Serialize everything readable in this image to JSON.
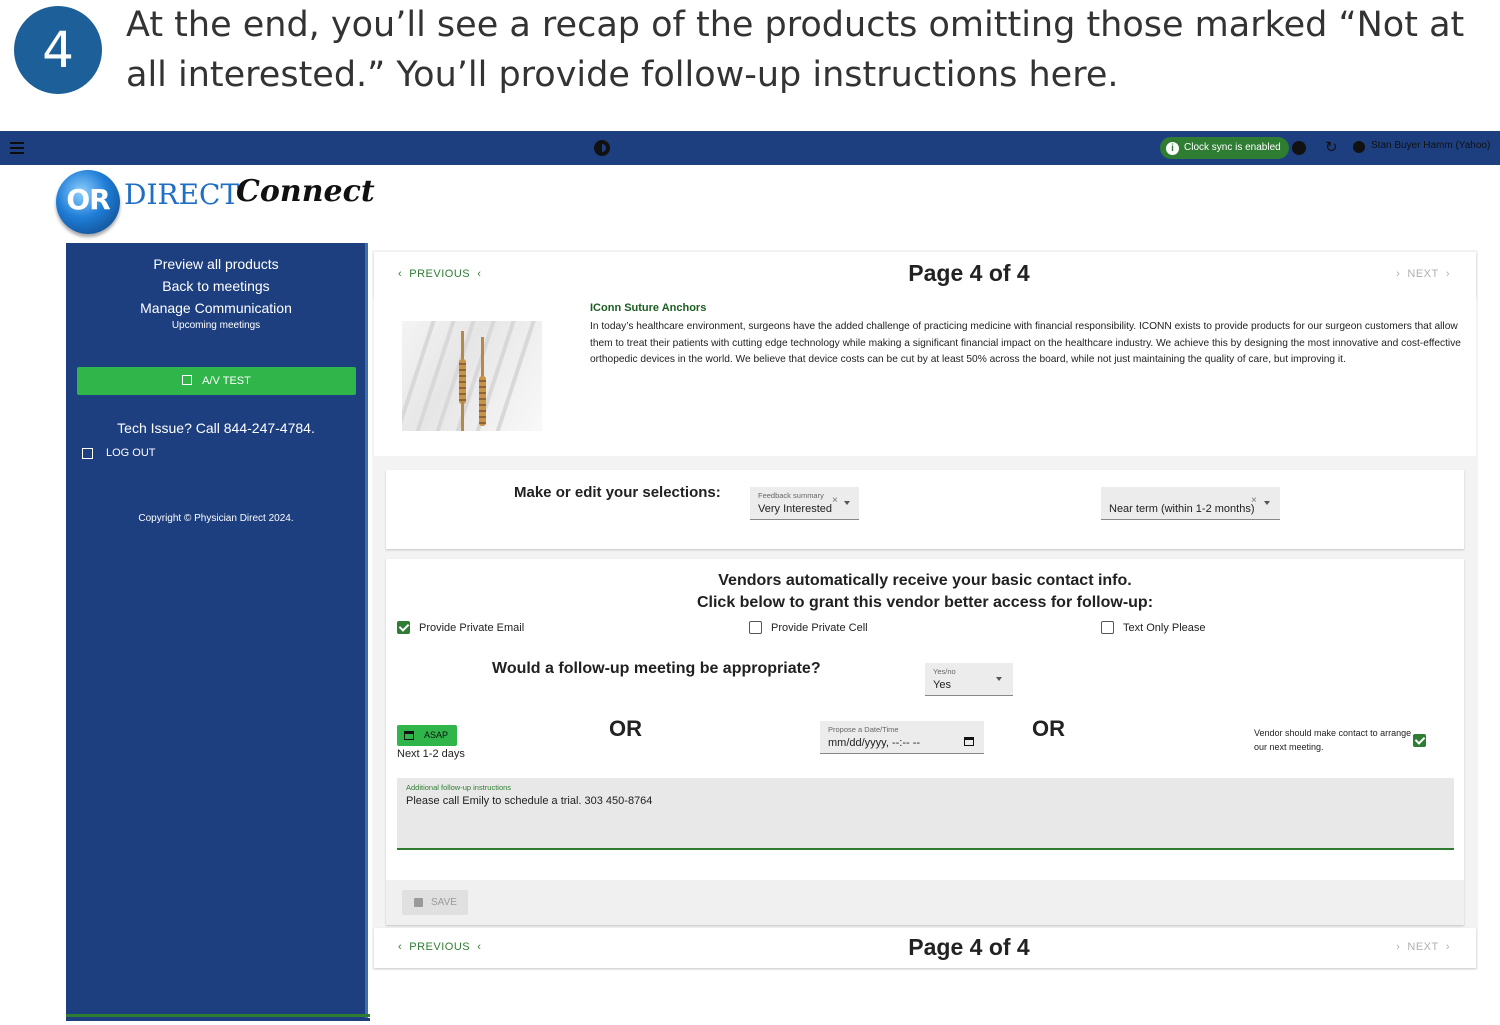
{
  "instruction": {
    "step": "4",
    "text": "At the end, you’ll see a recap of the products omitting those marked “Not at all interested.” You’ll provide follow-up instructions here."
  },
  "topbar": {
    "clock_sync": "Clock sync is enabled",
    "user": "Stan Buyer Hamm (Yahoo)"
  },
  "logo": {
    "or": "OR",
    "direct": "DIRECT",
    "connect": "Connect"
  },
  "sidebar": {
    "links": [
      "Preview all products",
      "Back to meetings",
      "Manage Communication"
    ],
    "upcoming": "Upcoming meetings",
    "av_test": "A/V TEST",
    "tech_issue": "Tech Issue? Call 844-247-4784.",
    "logout": "LOG OUT",
    "copyright": "Copyright © Physician Direct 2024."
  },
  "pager": {
    "previous": "PREVIOUS",
    "next": "NEXT",
    "title": "Page 4 of 4"
  },
  "product": {
    "name": "IConn Suture Anchors",
    "description": "In today’s healthcare environment, surgeons have the added challenge of practicing medicine with financial responsibility. ICONN exists to provide products for our surgeon customers that allow them to treat their patients with cutting edge technology while making a significant financial impact on the healthcare industry. We achieve this by designing the most innovative and cost-effective orthopedic devices in the world. We believe that device costs can be cut by at least 50% across the board, while not just maintaining the quality of care, but improving it."
  },
  "selections": {
    "label": "Make or edit your selections:",
    "feedback_caption": "Feedback summary",
    "feedback_value": "Very Interested",
    "timeline_value": "Near term (within 1-2 months)"
  },
  "followup": {
    "line1": "Vendors automatically receive your basic contact info.",
    "line2": "Click below to grant this vendor better access for follow-up:",
    "options": [
      {
        "label": "Provide Private Email",
        "checked": true
      },
      {
        "label": "Provide Private Cell",
        "checked": false
      },
      {
        "label": "Text Only Please",
        "checked": false
      }
    ],
    "meeting_question": "Would a follow-up meeting be appropriate?",
    "yesno_caption": "Yes/no",
    "yesno_value": "Yes",
    "asap": "ASAP",
    "next_days": "Next 1-2 days",
    "or": "OR",
    "date_caption": "Propose a Date/Time",
    "date_placeholder": "mm/dd/yyyy, --:-- --",
    "vendor_contact": "Vendor should make contact to arrange our next meeting.",
    "vendor_contact_checked": true,
    "notes_caption": "Additional follow-up instructions",
    "notes_value": "Please call Emily to schedule a trial. 303 450-8764",
    "save": "SAVE"
  },
  "colors": {
    "primary": "#1d3f80",
    "accent_green": "#2fb54a",
    "dark_green": "#2e7d32",
    "badge_blue": "#1d5f98"
  }
}
